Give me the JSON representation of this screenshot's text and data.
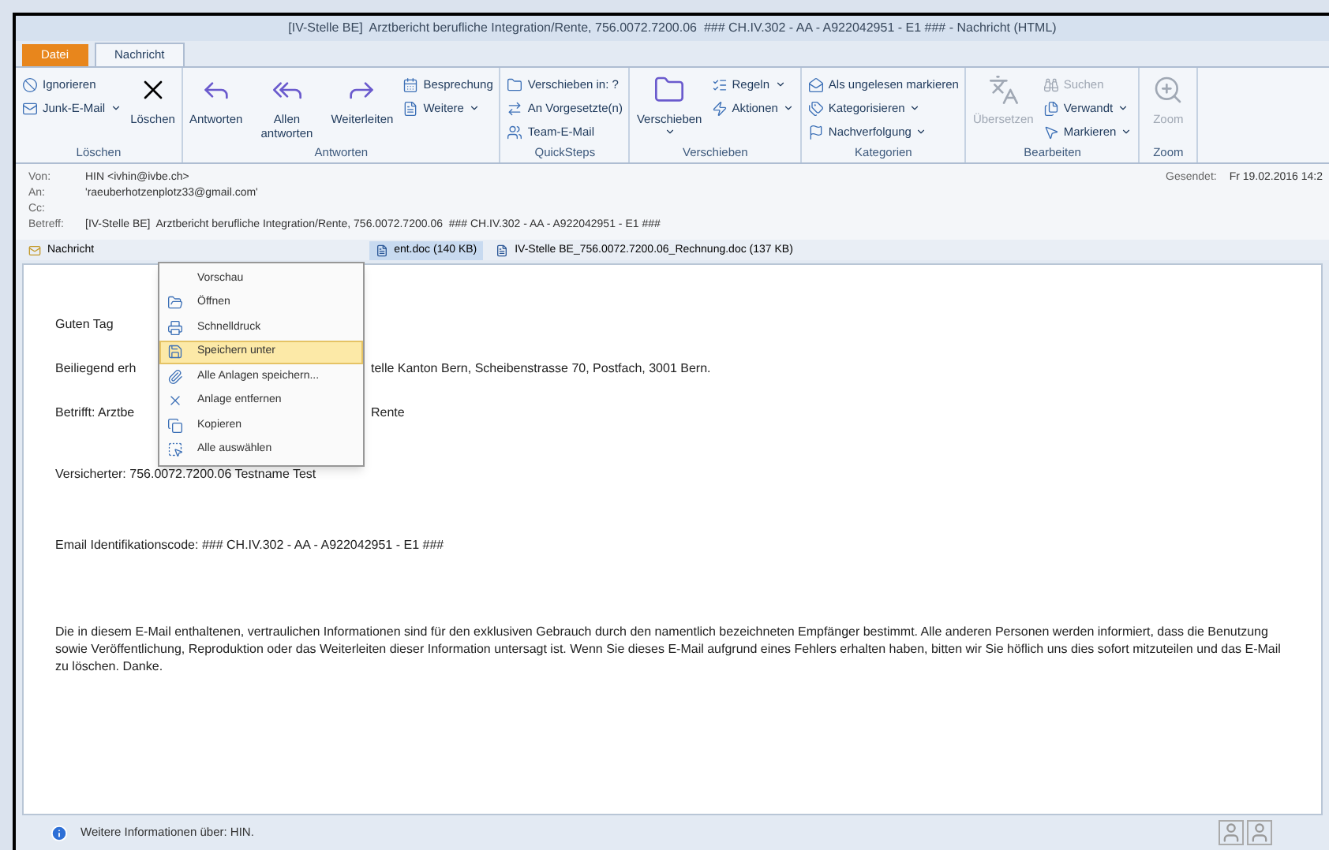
{
  "window": {
    "title": "[IV-Stelle BE]  Arztbericht berufliche Integration/Rente, 756.0072.7200.06  ### CH.IV.302 - AA - A922042951 - E1 ### - Nachricht (HTML)"
  },
  "tabs": [
    {
      "label": "Datei",
      "kind": "file",
      "selected": false
    },
    {
      "label": "Nachricht",
      "kind": "tab",
      "selected": true
    }
  ],
  "ribbon": [
    {
      "label": "Löschen",
      "buttons": [
        {
          "label": "Ignorieren",
          "kind": "small",
          "dropdown": false,
          "disabled": false
        },
        {
          "label": "Junk-E-Mail",
          "kind": "small",
          "dropdown": true,
          "disabled": false
        },
        {
          "label": "Löschen",
          "kind": "large",
          "dropdown": false,
          "disabled": false
        }
      ]
    },
    {
      "label": "Antworten",
      "buttons": [
        {
          "label": "Antworten",
          "kind": "large",
          "dropdown": false,
          "disabled": false
        },
        {
          "label": "Allen antworten",
          "kind": "large",
          "dropdown": false,
          "disabled": false
        },
        {
          "label": "Weiterleiten",
          "kind": "large",
          "dropdown": false,
          "disabled": false
        },
        {
          "label": "Besprechung",
          "kind": "small",
          "dropdown": false,
          "disabled": false
        },
        {
          "label": "Weitere",
          "kind": "small",
          "dropdown": true,
          "disabled": false
        }
      ]
    },
    {
      "label": "QuickSteps",
      "buttons": [
        {
          "label": "Verschieben in: ?",
          "kind": "small",
          "dropdown": false,
          "disabled": false
        },
        {
          "label": "An Vorgesetzte(n)",
          "kind": "small",
          "dropdown": false,
          "disabled": false
        },
        {
          "label": "Team-E-Mail",
          "kind": "small",
          "dropdown": false,
          "disabled": false
        }
      ]
    },
    {
      "label": "Verschieben",
      "buttons": [
        {
          "label": "Verschieben",
          "kind": "large",
          "dropdown": true,
          "disabled": false
        },
        {
          "label": "Regeln",
          "kind": "small",
          "dropdown": true,
          "disabled": false
        },
        {
          "label": "Aktionen",
          "kind": "small",
          "dropdown": true,
          "disabled": false
        }
      ]
    },
    {
      "label": "Kategorien",
      "buttons": [
        {
          "label": "Als ungelesen markieren",
          "kind": "small",
          "dropdown": false,
          "disabled": false
        },
        {
          "label": "Kategorisieren",
          "kind": "small",
          "dropdown": true,
          "disabled": false
        },
        {
          "label": "Nachverfolgung",
          "kind": "small",
          "dropdown": true,
          "disabled": false
        }
      ]
    },
    {
      "label": "Bearbeiten",
      "buttons": [
        {
          "label": "Übersetzen",
          "kind": "large",
          "dropdown": false,
          "disabled": true
        },
        {
          "label": "Suchen",
          "kind": "small",
          "dropdown": false,
          "disabled": true
        },
        {
          "label": "Verwandt",
          "kind": "small",
          "dropdown": true,
          "disabled": false
        },
        {
          "label": "Markieren",
          "kind": "small",
          "dropdown": true,
          "disabled": false
        }
      ]
    },
    {
      "label": "Zoom",
      "buttons": [
        {
          "label": "Zoom",
          "kind": "large",
          "dropdown": false,
          "disabled": true
        }
      ]
    }
  ],
  "header": {
    "fields": [
      {
        "label": "Von:",
        "value": "HIN <ivhin@ivbe.ch>"
      },
      {
        "label": "An:",
        "value": "'raeuberhotzenplotz33@gmail.com'"
      },
      {
        "label": "Cc:"
      },
      {
        "label": "Betreff:",
        "value": "[IV-Stelle BE]  Arztbericht berufliche Integration/Rente, 756.0072.7200.06  ### CH.IV.302 - AA - A922042951 - E1 ###"
      }
    ],
    "sent_label": "Gesendet:",
    "sent_value": "Fr 19.02.2016 14:2"
  },
  "attachments": [
    {
      "label": "Nachricht",
      "kind": "message",
      "selected": false
    },
    {
      "label": "ent.doc (140 KB)",
      "kind": "doc",
      "selected": true
    },
    {
      "label": "IV-Stelle BE_756.0072.7200.06_Rechnung.doc (137 KB)",
      "kind": "doc",
      "selected": false
    }
  ],
  "body": [
    {
      "left": "Guten Tag"
    },
    {
      "left": "Beiliegend erh",
      "right": "telle Kanton Bern, Scheibenstrasse 70, Postfach, 3001 Bern."
    },
    {
      "left": "Betrifft: Arztbe",
      "right": "Rente"
    },
    {
      "left": "Versicherter: 756.0072.7200.06  Testname  Test"
    },
    {
      "left": "Email Identifikationscode:  ### CH.IV.302 - AA - A922042951 - E1 ###"
    },
    {
      "left": "Die in diesem E-Mail enthaltenen, vertraulichen Informationen sind für den exklusiven Gebrauch durch den namentlich bezeichneten Empfänger bestimmt. Alle anderen Personen werden informiert, dass die Benutzung sowie Veröffentlichung, Reproduktion oder das Weiterleiten dieser Information untersagt ist. Wenn Sie dieses E-Mail aufgrund eines Fehlers erhalten haben, bitten wir Sie höflich uns dies sofort mitzuteilen und das E-Mail zu löschen. Danke."
    }
  ],
  "context_menu": [
    {
      "label": "Vorschau",
      "selected": false
    },
    {
      "label": "Öffnen",
      "selected": false
    },
    {
      "label": "Schnelldruck",
      "selected": false
    },
    {
      "label": "Speichern unter",
      "selected": true
    },
    {
      "label": "Alle Anlagen speichern...",
      "selected": false
    },
    {
      "label": "Anlage entfernen",
      "selected": false
    },
    {
      "label": "Kopieren",
      "selected": false
    },
    {
      "label": "Alle auswählen",
      "selected": false
    }
  ],
  "status_bar": {
    "text": "Weitere Informationen über: HIN."
  }
}
